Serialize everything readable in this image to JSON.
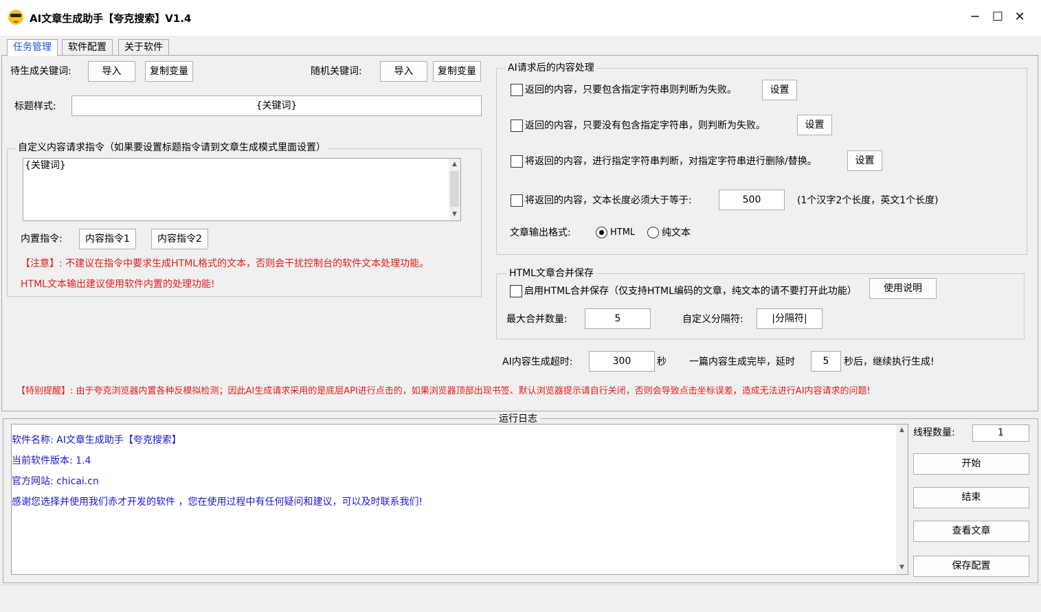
{
  "window": {
    "title": "AI文章生成助手【夸克搜索】V1.4",
    "minimize": "─",
    "maximize": "☐",
    "close": "✕"
  },
  "tabs": [
    "任务管理",
    "软件配置",
    "关于软件"
  ],
  "keywords": {
    "pending_label": "待生成关键词:",
    "import": "导入",
    "copy_var": "复制变量",
    "random_label": "随机关键词:",
    "title_style_label": "标题样式:",
    "title_style_value": "{关键词}"
  },
  "custom_prompt": {
    "legend": "自定义内容请求指令（如果要设置标题指令请到文章生成模式里面设置）",
    "text": "{关键词}",
    "builtin_label": "内置指令:",
    "builtin_1": "内容指令1",
    "builtin_2": "内容指令2",
    "notice_1": "【注意】: 不建议在指令中要求生成HTML格式的文本，否则会干扰控制台的软件文本处理功能。",
    "notice_2": "HTML文本输出建议使用软件内置的处理功能!"
  },
  "post_process": {
    "legend": "AI请求后的内容处理",
    "rule_1": "返回的内容，只要包含指定字符串则判断为失败。",
    "rule_2": "返回的内容，只要没有包含指定字符串，则判断为失败。",
    "rule_3": "将返回的内容，进行指定字符串判断，对指定字符串进行删除/替换。",
    "rule_4": "将返回的内容，文本长度必须大于等于:",
    "min_length": "500",
    "length_note": "(1个汉字2个长度，英文1个长度)",
    "set": "设置",
    "format_label": "文章输出格式:",
    "format_html": "HTML",
    "format_plain": "纯文本"
  },
  "html_merge": {
    "legend": "HTML文章合并保存",
    "enable": "启用HTML合并保存（仅支持HTML编码的文章，纯文本的请不要打开此功能）",
    "help": "使用说明",
    "max_label": "最大合并数量:",
    "max_value": "5",
    "sep_label": "自定义分隔符:",
    "sep_value": "|分隔符|"
  },
  "timeout": {
    "label": "AI内容生成超时:",
    "value": "300",
    "unit": "秒",
    "delay_label": "一篇内容生成完毕，延时",
    "delay_value": "5",
    "delay_suffix": "秒后，继续执行生成!"
  },
  "special_notice": "【特别提醒】: 由于夸克浏览器内置各种反模拟检测；因此AI生成请求采用的是底层API进行点击的，如果浏览器顶部出现书签、默认浏览器提示请自行关闭，否则会导致点击坐标误差，造成无法进行AI内容请求的问题!",
  "log": {
    "legend": "运行日志",
    "lines": [
      "软件名称: AI文章生成助手【夸克搜索】",
      "当前软件版本: 1.4",
      "官方网站: chicai.cn",
      "感谢您选择并使用我们赤才开发的软件 ，您在使用过程中有任何疑问和建议，可以及时联系我们!"
    ]
  },
  "controls": {
    "threads_label": "线程数量:",
    "threads_value": "1",
    "start": "开始",
    "stop": "结束",
    "view": "查看文章",
    "save": "保存配置"
  },
  "colors": {
    "accent": "#1a55d8",
    "warning": "#e41b1b",
    "log_text": "#1919cc"
  }
}
